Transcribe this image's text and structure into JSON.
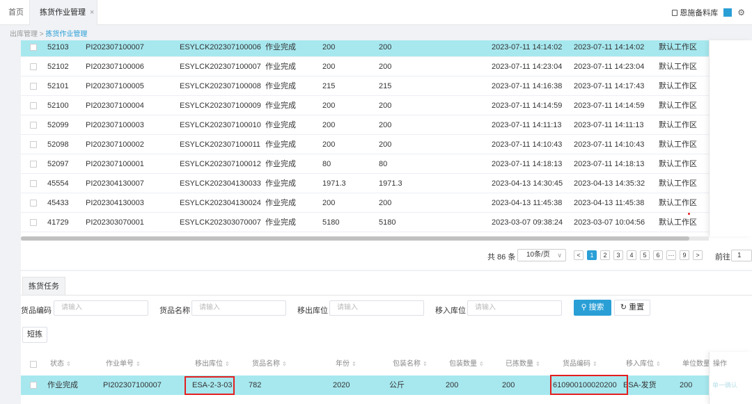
{
  "tabs": {
    "home": "首页",
    "active": "拣货作业管理",
    "close": "×"
  },
  "topbar": {
    "warehouse": "恩施备料库",
    "accent_color": "#2a9fd6",
    "icons": [
      "warehouse-icon",
      "gear-icon"
    ]
  },
  "breadcrumb": {
    "parent": "出库管理",
    "separator": " > ",
    "current": "拣货作业管理"
  },
  "upper_table": {
    "rows": [
      {
        "id": "52103",
        "order": "PI202307100007",
        "task": "ESYLCK202307100006",
        "status": "作业完成",
        "qty1": "200",
        "qty2": "200",
        "start": "2023-07-11 14:14:02",
        "end": "2023-07-11 14:14:02",
        "area": "默认工作区",
        "selected": true
      },
      {
        "id": "52102",
        "order": "PI202307100006",
        "task": "ESYLCK202307100007",
        "status": "作业完成",
        "qty1": "200",
        "qty2": "200",
        "start": "2023-07-11 14:23:04",
        "end": "2023-07-11 14:23:04",
        "area": "默认工作区",
        "selected": false
      },
      {
        "id": "52101",
        "order": "PI202307100005",
        "task": "ESYLCK202307100008",
        "status": "作业完成",
        "qty1": "215",
        "qty2": "215",
        "start": "2023-07-11 14:16:38",
        "end": "2023-07-11 14:17:43",
        "area": "默认工作区",
        "selected": false
      },
      {
        "id": "52100",
        "order": "PI202307100004",
        "task": "ESYLCK202307100009",
        "status": "作业完成",
        "qty1": "200",
        "qty2": "200",
        "start": "2023-07-11 14:14:59",
        "end": "2023-07-11 14:14:59",
        "area": "默认工作区",
        "selected": false
      },
      {
        "id": "52099",
        "order": "PI202307100003",
        "task": "ESYLCK202307100010",
        "status": "作业完成",
        "qty1": "200",
        "qty2": "200",
        "start": "2023-07-11 14:11:13",
        "end": "2023-07-11 14:11:13",
        "area": "默认工作区",
        "selected": false
      },
      {
        "id": "52098",
        "order": "PI202307100002",
        "task": "ESYLCK202307100011",
        "status": "作业完成",
        "qty1": "200",
        "qty2": "200",
        "start": "2023-07-11 14:10:43",
        "end": "2023-07-11 14:10:43",
        "area": "默认工作区",
        "selected": false
      },
      {
        "id": "52097",
        "order": "PI202307100001",
        "task": "ESYLCK202307100012",
        "status": "作业完成",
        "qty1": "80",
        "qty2": "80",
        "start": "2023-07-11 14:18:13",
        "end": "2023-07-11 14:18:13",
        "area": "默认工作区",
        "selected": false
      },
      {
        "id": "45554",
        "order": "PI202304130007",
        "task": "ESYLCK202304130033",
        "status": "作业完成",
        "qty1": "1971.3",
        "qty2": "1971.3",
        "start": "2023-04-13 14:30:45",
        "end": "2023-04-13 14:35:32",
        "area": "默认工作区",
        "selected": false
      },
      {
        "id": "45433",
        "order": "PI202304130003",
        "task": "ESYLCK202304130024",
        "status": "作业完成",
        "qty1": "200",
        "qty2": "200",
        "start": "2023-04-13 11:45:38",
        "end": "2023-04-13 11:45:38",
        "area": "默认工作区",
        "selected": false
      },
      {
        "id": "41729",
        "order": "PI202303070001",
        "task": "ESYLCK202303070007",
        "status": "作业完成",
        "qty1": "5180",
        "qty2": "5180",
        "start": "2023-03-07 09:38:24",
        "end": "2023-03-07 10:04:56",
        "area": "默认工作区",
        "selected": false
      }
    ]
  },
  "pagination": {
    "total": "共 86 条",
    "page_size": "10条/页",
    "prev": "<",
    "pages": [
      "1",
      "2",
      "3",
      "4",
      "5",
      "6"
    ],
    "ellipsis": "···",
    "last": "9",
    "next": ">",
    "goto_label": "前往",
    "goto_value": "1",
    "current_page": "1"
  },
  "task_section": {
    "tab_label": "拣货任务",
    "filters": [
      {
        "label": "货品编码",
        "placeholder": "请输入"
      },
      {
        "label": "货品名称",
        "placeholder": "请输入"
      },
      {
        "label": "移出库位",
        "placeholder": "请输入"
      },
      {
        "label": "移入库位",
        "placeholder": "请输入"
      }
    ],
    "search_label": "搜索",
    "reset_label": "重置",
    "short_pick_label": "短拣",
    "columns": [
      {
        "label": "状态"
      },
      {
        "label": "作业单号"
      },
      {
        "label": "移出库位"
      },
      {
        "label": "货品名称"
      },
      {
        "label": "年份"
      },
      {
        "label": "包装名称"
      },
      {
        "label": "包装数量"
      },
      {
        "label": "已拣数量"
      },
      {
        "label": "货品编码"
      },
      {
        "label": "移入库位"
      },
      {
        "label": "单位数量"
      },
      {
        "label": "操作"
      }
    ],
    "row": {
      "status": "作业完成",
      "order": "PI202307100007",
      "from_loc": "ESA-2-3-03",
      "item_name": "782",
      "year": "2020",
      "pack_name": "公斤",
      "pack_qty": "200",
      "picked_qty": "200",
      "item_code": "610900100020200",
      "to_loc": "ESA-发货",
      "unit_qty": "200",
      "action": "单一确认"
    }
  },
  "highlight_color": "#e41e1e",
  "selected_row_color": "#a7e8ef"
}
